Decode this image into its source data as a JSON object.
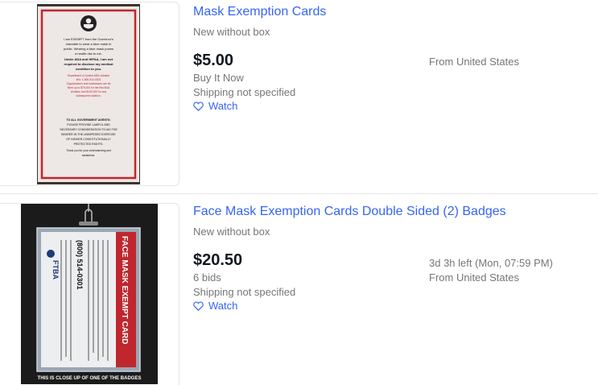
{
  "listings": [
    {
      "title": "Mask Exemption Cards",
      "condition": "New without box",
      "price": "$5.00",
      "purchase_format": "Buy It Now",
      "shipping": "Shipping not specified",
      "watch_label": "Watch",
      "time_left": "",
      "location": "From United States",
      "image": {
        "card_text": {
          "line1": "I am EXEMPT from the Governor's",
          "line2": "mandate to wear a face mask in",
          "line3": "public. Wearing a face mask poses",
          "line4": "a health risk to me.",
          "line5": "Under ADA and HIPAA, I am not",
          "line6": "required to disclose my medical",
          "line7": "condition to you.",
          "line8": "Department of Justice ADA violation",
          "line9": "info: 1-800-514-0301",
          "line10": "Organizations and businesses can be",
          "line11": "fined up to $75,000 for the first ADA",
          "line12": "violation and $150,000 for any",
          "line13": "subsequent violation.",
          "line14": "TO ALL GOVERNMENT AGENTS:",
          "line15": "PLEASE PROVIDE LAWFUL AND",
          "line16": "NECESSARY CONSIDERATION TO AID THE",
          "line17": "BEARER IN THE UNIMPEDED EXERCISE",
          "line18": "OF HIS/HER CONSTITUTIONALLY",
          "line19": "PROTECTED RIGHTS.",
          "line20": "Thank you for your understanding and",
          "line21": "assistance."
        }
      }
    },
    {
      "title": "Face Mask Exemption Cards Double Sided (2) Badges",
      "condition": "New without box",
      "price": "$20.50",
      "purchase_format": "6 bids",
      "shipping": "Shipping not specified",
      "watch_label": "Watch",
      "time_left": "3d 3h left (Mon, 07:59 PM)",
      "location": "From United States",
      "image": {
        "banner": "FACE MASK EXEMPT CARD",
        "logo": "FTBA",
        "phone": "(800) 514-0301",
        "caption": "THIS IS CLOSE UP OF ONE OF THE BADGES"
      }
    }
  ],
  "colors": {
    "link": "#3665f3",
    "secondary_text": "#767676",
    "price_text": "#111820",
    "card_red": "#c0262d"
  },
  "icons": {
    "watch": "heart-outline-icon"
  }
}
